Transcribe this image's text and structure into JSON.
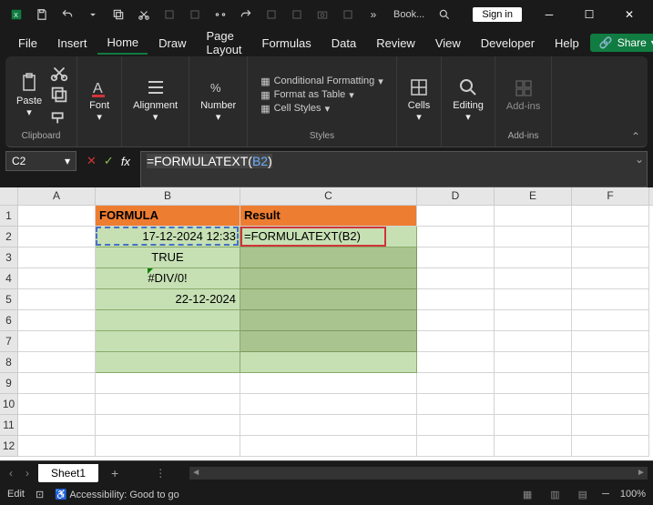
{
  "titlebar": {
    "doc_title": "Book...",
    "signin": "Sign in"
  },
  "menubar": {
    "items": [
      "File",
      "Insert",
      "Home",
      "Draw",
      "Page Layout",
      "Formulas",
      "Data",
      "Review",
      "View",
      "Developer",
      "Help"
    ],
    "active_index": 2,
    "share": "Share"
  },
  "ribbon": {
    "clipboard": {
      "paste": "Paste",
      "label": "Clipboard"
    },
    "font": {
      "label": "Font",
      "button": "Font"
    },
    "alignment": {
      "label": "Alignment",
      "button": "Alignment"
    },
    "number": {
      "label": "Number",
      "button": "Number"
    },
    "styles": {
      "label": "Styles",
      "cf": "Conditional Formatting",
      "fat": "Format as Table",
      "cs": "Cell Styles"
    },
    "cells": {
      "button": "Cells"
    },
    "editing": {
      "button": "Editing"
    },
    "addins": {
      "button": "Add-ins",
      "label": "Add-ins"
    }
  },
  "formula_bar": {
    "name_box": "C2",
    "fx": "fx",
    "formula_prefix": "=FORMULATEXT(",
    "formula_ref": "B2",
    "formula_suffix": ")"
  },
  "grid": {
    "cols": [
      "A",
      "B",
      "C",
      "D",
      "E",
      "F"
    ],
    "rows": [
      "1",
      "2",
      "3",
      "4",
      "5",
      "6",
      "7",
      "8",
      "9",
      "10",
      "11",
      "12"
    ],
    "headers": {
      "B1": "FORMULA",
      "C1": "Result"
    },
    "data": {
      "B2": "17-12-2024 12:33",
      "B3": "TRUE",
      "B4": "#DIV/0!",
      "B5": "22-12-2024",
      "C2": "=FORMULATEXT(B2)"
    }
  },
  "sheet_tabs": {
    "active": "Sheet1"
  },
  "statusbar": {
    "mode": "Edit",
    "accessibility": "Accessibility: Good to go",
    "zoom": "100%"
  },
  "chart_data": {
    "type": "table",
    "title": "",
    "columns": [
      "FORMULA",
      "Result"
    ],
    "rows": [
      [
        "17-12-2024 12:33",
        "=FORMULATEXT(B2)"
      ],
      [
        "TRUE",
        ""
      ],
      [
        "#DIV/0!",
        ""
      ],
      [
        "22-12-2024",
        ""
      ]
    ]
  }
}
